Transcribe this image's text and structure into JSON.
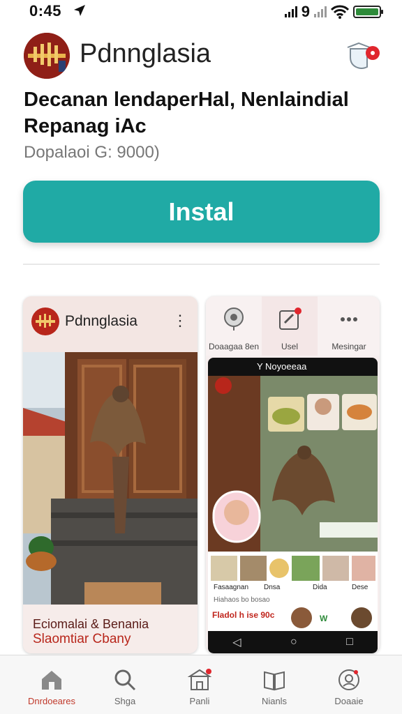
{
  "status_bar": {
    "time": "0:45",
    "signal_text": "9"
  },
  "header": {
    "app_name": "Pdnnglasia",
    "description": "Decanan lendaperHal, Nenlaindial Repanag iAc",
    "meta": "Dopalaoi G: 9000)"
  },
  "install_button": {
    "label": "Instal"
  },
  "screenshot_1": {
    "title": "Pdnnglasia",
    "caption_line1": "Eciomalai & Benania",
    "caption_line2": "Slaomtiar Cbany"
  },
  "screenshot_2": {
    "tabs": [
      "Doaagaa 8en",
      "Usel",
      "Mesingar"
    ],
    "phone_title": "Y Noyoeeaa",
    "row_labels": [
      "Fasaagnan",
      "Dnsa",
      "Dida",
      "Dese"
    ],
    "promo_line1": "Hiahaos bo bosao",
    "promo_line2": "Fladol h ise 90c"
  },
  "bottom_nav": {
    "items": [
      {
        "label": "Dnrdoeares",
        "icon": "home-icon",
        "active": true
      },
      {
        "label": "Shga",
        "icon": "search-icon",
        "active": false
      },
      {
        "label": "Panli",
        "icon": "store-icon",
        "active": false
      },
      {
        "label": "Nianls",
        "icon": "book-icon",
        "active": false
      },
      {
        "label": "Doaaie",
        "icon": "profile-icon",
        "active": false
      }
    ]
  },
  "colors": {
    "accent": "#20aaa5",
    "brand": "#b8261b",
    "active_nav": "#c0392b"
  }
}
